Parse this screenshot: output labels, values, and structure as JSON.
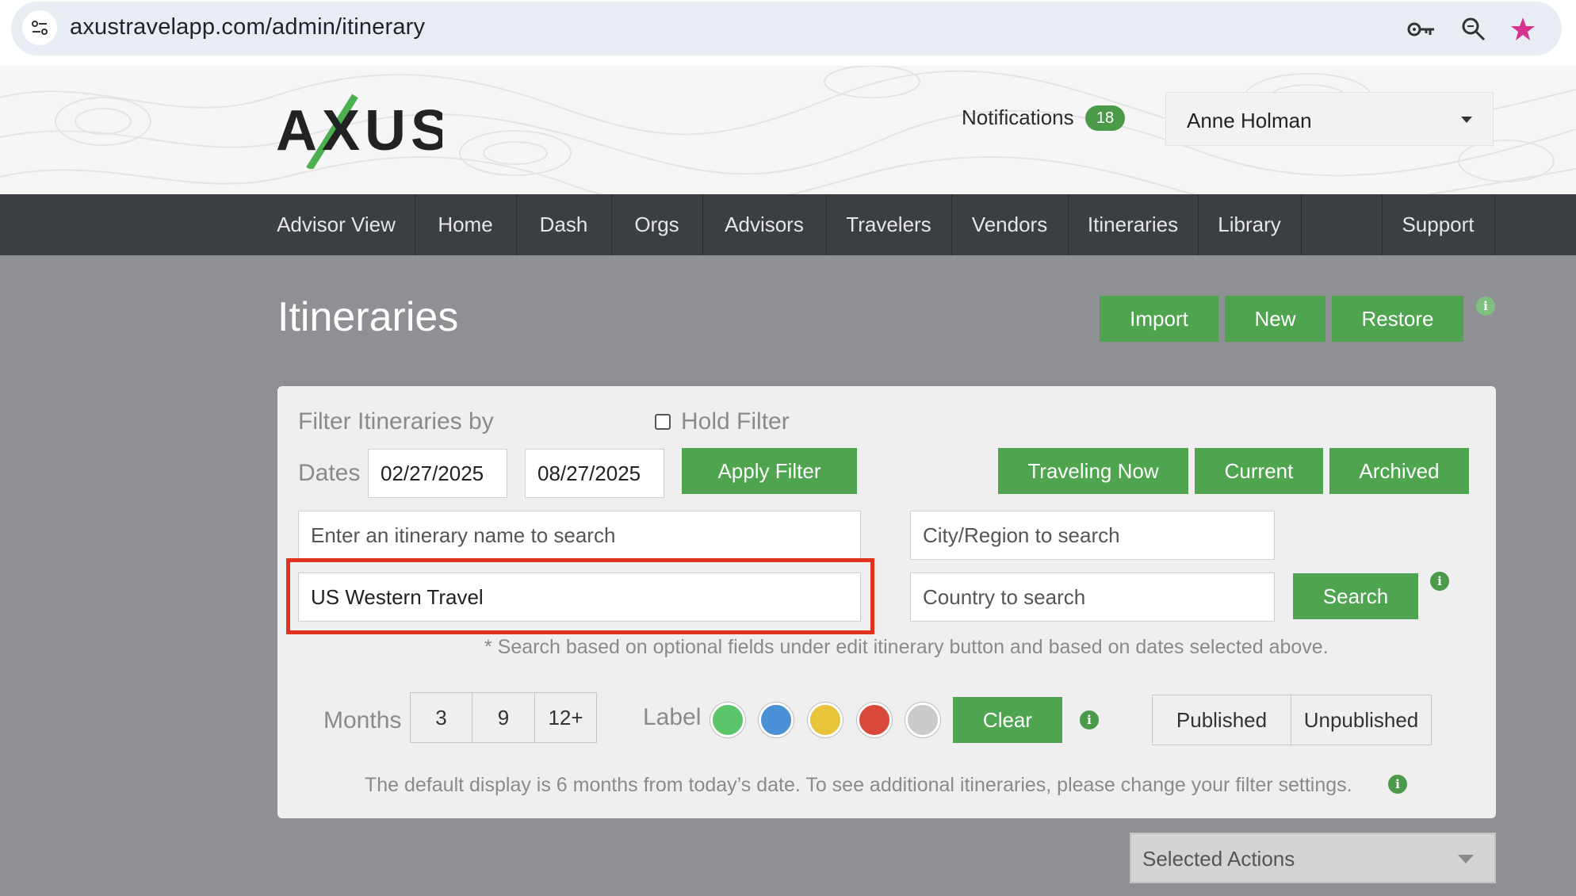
{
  "browser": {
    "url": "axustravelapp.com/admin/itinerary",
    "icons": [
      "site-settings-icon",
      "key-icon",
      "zoom-icon",
      "bookmark-star-icon"
    ]
  },
  "header": {
    "logo_text": "AXUS",
    "notifications_label": "Notifications",
    "notifications_count": "18",
    "user_name": "Anne Holman"
  },
  "nav": {
    "items": [
      "Advisor View",
      "Home",
      "Dash",
      "Orgs",
      "Advisors",
      "Travelers",
      "Vendors",
      "Itineraries",
      "Library",
      "Support"
    ]
  },
  "page": {
    "title": "Itineraries",
    "import_label": "Import",
    "new_label": "New",
    "restore_label": "Restore"
  },
  "filter": {
    "filter_by_label": "Filter Itineraries by",
    "hold_filter_label": "Hold Filter",
    "hold_filter_checked": false,
    "dates_label": "Dates",
    "start_date": "02/27/2025",
    "end_date": "08/27/2025",
    "apply_label": "Apply Filter",
    "traveling_now_label": "Traveling Now",
    "current_label": "Current",
    "archived_label": "Archived",
    "name_search_placeholder": "Enter an itinerary name to search",
    "name_search_value": "US Western Travel",
    "city_placeholder": "City/Region to search",
    "country_placeholder": "Country to search",
    "search_label": "Search",
    "search_hint": "* Search based on optional fields under edit itinerary button and based on dates selected above.",
    "months_label": "Months",
    "months_options": [
      "3",
      "9",
      "12+"
    ],
    "label_label": "Label",
    "label_colors": [
      "#5cc46a",
      "#4a90d6",
      "#e8c43a",
      "#d9493b",
      "#c9ccc9"
    ],
    "clear_label": "Clear",
    "published_label": "Published",
    "unpublished_label": "Unpublished",
    "default_note": "The default display is 6 months from today’s date. To see additional itineraries, please change your filter settings."
  },
  "actions": {
    "selected_actions_label": "Selected Actions"
  },
  "colors": {
    "accent_green": "#4fa44f",
    "nav_bg": "#3b3e42",
    "page_bg": "#8f9094",
    "highlight_red": "#e0321f"
  }
}
